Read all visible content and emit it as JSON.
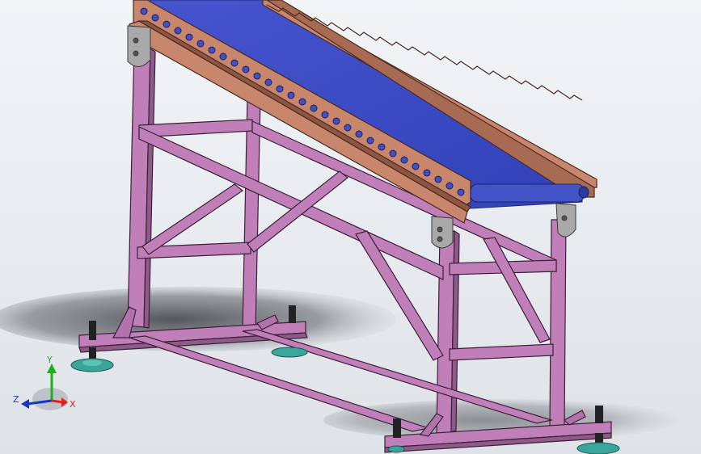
{
  "viewport": {
    "background_top": "#f2f4f7",
    "background_bottom": "#dfe3e8"
  },
  "model": {
    "frame_color": "#c07fb8",
    "frame_edge": "#3a2038",
    "rail_color": "#c8876d",
    "belt_color": "#3f4fc4",
    "foot_color": "#3aa59a",
    "screw_color": "#222222"
  },
  "triad": {
    "x_label": "X",
    "y_label": "Y",
    "z_label": "Z",
    "x_color": "#e02020",
    "y_color": "#18b21a",
    "z_color": "#1a34c8"
  }
}
